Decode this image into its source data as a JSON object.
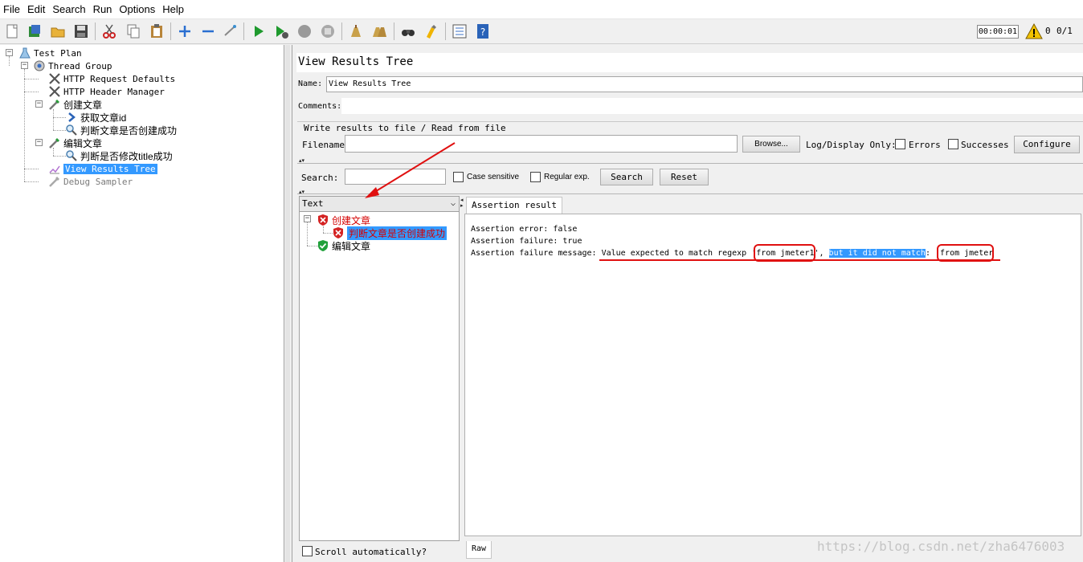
{
  "menu": [
    "File",
    "Edit",
    "Search",
    "Run",
    "Options",
    "Help"
  ],
  "toolbar": {
    "icons": [
      "new-icon",
      "templates-icon",
      "open-icon",
      "save-icon",
      "cut-icon",
      "copy-icon",
      "paste-icon",
      "expand-icon",
      "collapse-icon",
      "toggle-icon",
      "start-icon",
      "start-no-pauses-icon",
      "stop-icon",
      "shutdown-icon",
      "clear-icon",
      "clear-all-icon",
      "search-icon",
      "reset-search-icon",
      "function-helper-icon",
      "help-icon"
    ],
    "timer": "00:00:01",
    "warning_count": "0",
    "threads": "0/1"
  },
  "test_plan_tree": {
    "root": "Test Plan",
    "thread_group": "Thread Group",
    "items": [
      {
        "label": "HTTP Request Defaults"
      },
      {
        "label": "HTTP Header Manager"
      },
      {
        "label": "创建文章"
      },
      {
        "label": "获取文章id"
      },
      {
        "label": "判断文章是否创建成功"
      },
      {
        "label": "编辑文章"
      },
      {
        "label": "判断是否修改title成功"
      },
      {
        "label": "View Results Tree"
      },
      {
        "label": "Debug Sampler"
      }
    ]
  },
  "panel": {
    "title": "View Results Tree",
    "name_label": "Name:",
    "name_value": "View Results Tree",
    "comments_label": "Comments:",
    "comments_value": "",
    "write_results_title": "Write results to file / Read from file",
    "filename_label": "Filename",
    "filename_value": "",
    "browse_label": "Browse...",
    "log_display_label": "Log/Display Only:",
    "errors_label": "Errors",
    "successes_label": "Successes",
    "configure_label": "Configure",
    "search_label": "Search:",
    "search_value": "",
    "case_sensitive_label": "Case sensitive",
    "regular_exp_label": "Regular exp.",
    "search_button": "Search",
    "reset_button": "Reset"
  },
  "results": {
    "renderer": "Text",
    "tree": [
      {
        "label": "创建文章",
        "status": "fail"
      },
      {
        "label": "判断文章是否创建成功",
        "status": "fail"
      },
      {
        "label": "编辑文章",
        "status": "pass"
      }
    ],
    "scroll_auto_label": "Scroll automatically?"
  },
  "detail": {
    "tab": "Assertion result",
    "lines": [
      "Assertion error: false",
      "Assertion failure: true"
    ],
    "message_label": "Assertion failure message:",
    "message_part1": "Value expected to match regexp '",
    "regexp": "from jmeter1",
    "message_part2": "', ",
    "highlighted": "but it did not match",
    "message_part3": ": '",
    "actual": "from jmeter",
    "bottom_tab": "Raw"
  },
  "watermark": "https://blog.csdn.net/zha6476003",
  "colors": {
    "selection": "#3399ff",
    "annotation_red": "#e01010",
    "error_red": "#d40000"
  }
}
